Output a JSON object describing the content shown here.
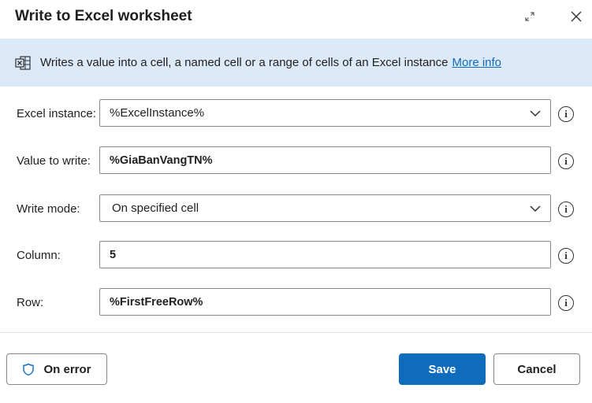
{
  "dialog": {
    "title": "Write to Excel worksheet",
    "expand_icon": "expand-icon",
    "close_icon": "close-icon"
  },
  "banner": {
    "icon": "excel-icon",
    "description": "Writes a value into a cell, a named cell or a range of cells of an Excel instance",
    "link": "More info",
    "background": "#dce9f9",
    "link_color": "#0f6cbd"
  },
  "form": {
    "excel_instance": {
      "label": "Excel instance:",
      "value": "%ExcelInstance%"
    },
    "value_to_write": {
      "label": "Value to write:",
      "value": "%GiaBanVangTN%"
    },
    "write_mode": {
      "label": "Write mode:",
      "value": "On specified cell"
    },
    "column": {
      "label": "Column:",
      "value": "5"
    },
    "row": {
      "label": "Row:",
      "value": "%FirstFreeRow%"
    },
    "info_glyph": "i"
  },
  "footer": {
    "on_error": "On error",
    "save": "Save",
    "cancel": "Cancel",
    "accent": "#0f6cbd"
  }
}
